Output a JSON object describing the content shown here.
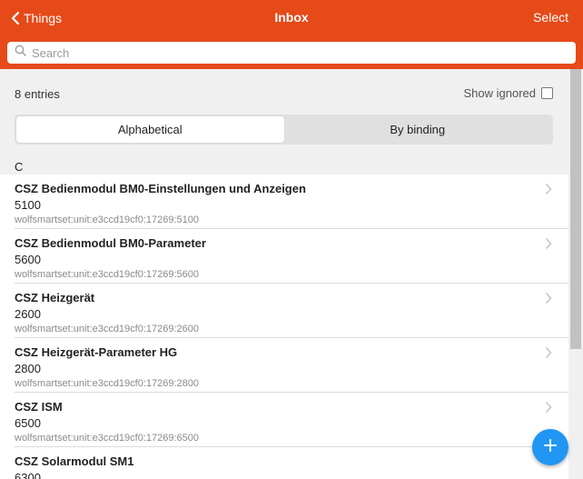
{
  "header": {
    "back_label": "Things",
    "title": "Inbox",
    "select_label": "Select",
    "accent_color": "#e64a19"
  },
  "search": {
    "placeholder": "Search",
    "value": ""
  },
  "summary": {
    "entries": "8 entries",
    "show_ignored_label": "Show ignored",
    "show_ignored_checked": false
  },
  "segments": {
    "options": [
      "Alphabetical",
      "By binding"
    ],
    "selected": "Alphabetical"
  },
  "section": {
    "letter": "C"
  },
  "items": [
    {
      "title": "CSZ Bedienmodul BM0-Einstellungen und Anzeigen",
      "sub": "5100",
      "uid": "wolfsmartset:unit:e3ccd19cf0:17269:5100"
    },
    {
      "title": "CSZ Bedienmodul BM0-Parameter",
      "sub": "5600",
      "uid": "wolfsmartset:unit:e3ccd19cf0:17269:5600"
    },
    {
      "title": "CSZ Heizgerät",
      "sub": "2600",
      "uid": "wolfsmartset:unit:e3ccd19cf0:17269:2600"
    },
    {
      "title": "CSZ Heizgerät-Parameter HG",
      "sub": "2800",
      "uid": "wolfsmartset:unit:e3ccd19cf0:17269:2800"
    },
    {
      "title": "CSZ ISM",
      "sub": "6500",
      "uid": "wolfsmartset:unit:e3ccd19cf0:17269:6500"
    },
    {
      "title": "CSZ Solarmodul SM1",
      "sub": "6300",
      "uid": ""
    }
  ],
  "icons": {
    "back": "chevron-left-icon",
    "search": "search-icon",
    "row": "chevron-right-icon",
    "fab": "plus-icon"
  },
  "fab_color": "#2196f3"
}
